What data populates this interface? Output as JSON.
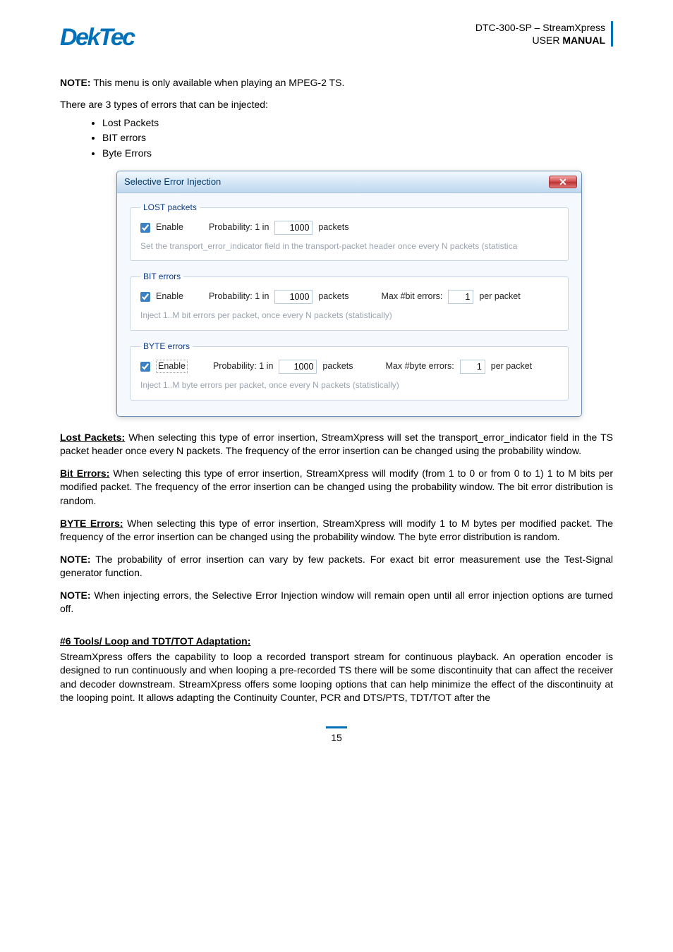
{
  "header": {
    "logo_text": "DekTec",
    "product": "DTC-300-SP – StreamXpress",
    "doc_line": "USER MANUAL"
  },
  "note1_label": "NOTE:",
  "note1_text": " This menu is only available when playing an MPEG-2 TS.",
  "intro_types": "There are 3 types of errors that can be injected:",
  "types": [
    "Lost Packets",
    "BIT errors",
    "Byte Errors"
  ],
  "dialog": {
    "title": "Selective Error Injection",
    "close_glyph": "✕",
    "groups": {
      "lost": {
        "legend": "LOST packets",
        "enable": "Enable",
        "prob_label": "Probability:  1 in",
        "prob_value": "1000",
        "unit": "packets",
        "desc": "Set the transport_error_indicator field in the transport-packet header once every N packets (statistica"
      },
      "bit": {
        "legend": "BIT errors",
        "enable": "Enable",
        "prob_label": "Probability:  1 in",
        "prob_value": "1000",
        "unit": "packets",
        "max_label": "Max #bit errors:",
        "max_value": "1",
        "per": "per packet",
        "desc": "Inject 1..M bit errors per packet, once every N packets (statistically)"
      },
      "byte": {
        "legend": "BYTE errors",
        "enable": "Enable",
        "prob_label": "Probability:  1 in",
        "prob_value": "1000",
        "unit": "packets",
        "max_label": "Max #byte errors:",
        "max_value": "1",
        "per": "per packet",
        "desc": "Inject 1..M byte errors per packet, once every N packets (statistically)"
      }
    }
  },
  "lost_head": "Lost Packets:",
  "lost_para": " When selecting this type of error insertion, StreamXpress will set the transport_error_indicator field in the TS packet header once every N packets. The frequency of the error insertion can be changed using the probability window.",
  "bit_head": "Bit Errors:",
  "bit_para": " When selecting this type of error insertion, StreamXpress will modify (from 1 to 0 or from 0 to 1) 1 to M bits per modified packet. The frequency of the error insertion can be changed using the probability window. The bit error distribution is random.",
  "byte_head": "BYTE Errors:",
  "byte_para": " When selecting this type of error insertion, StreamXpress will modify 1 to M bytes per modified packet. The frequency of the error insertion can be changed using the probability window. The byte error distribution is random.",
  "note2_label": "NOTE:",
  "note2_text": " The probability of error insertion can vary by few packets. For exact bit error measurement use the Test-Signal generator function.",
  "note3_label": "NOTE:",
  "note3_text": " When injecting errors, the Selective Error Injection window will remain open until all error injection options are turned off.",
  "tools_head": "#6 Tools/ Loop and TDT/TOT Adaptation:",
  "tools_para": "StreamXpress offers the capability to loop a recorded transport stream for continuous playback. An operation encoder is designed to run continuously and when looping a pre-recorded TS there will be some discontinuity that can affect the receiver and decoder downstream. StreamXpress offers some looping options that can help minimize the effect of the discontinuity at the looping point. It allows adapting the Continuity Counter, PCR and DTS/PTS, TDT/TOT after the",
  "page_number": "15"
}
